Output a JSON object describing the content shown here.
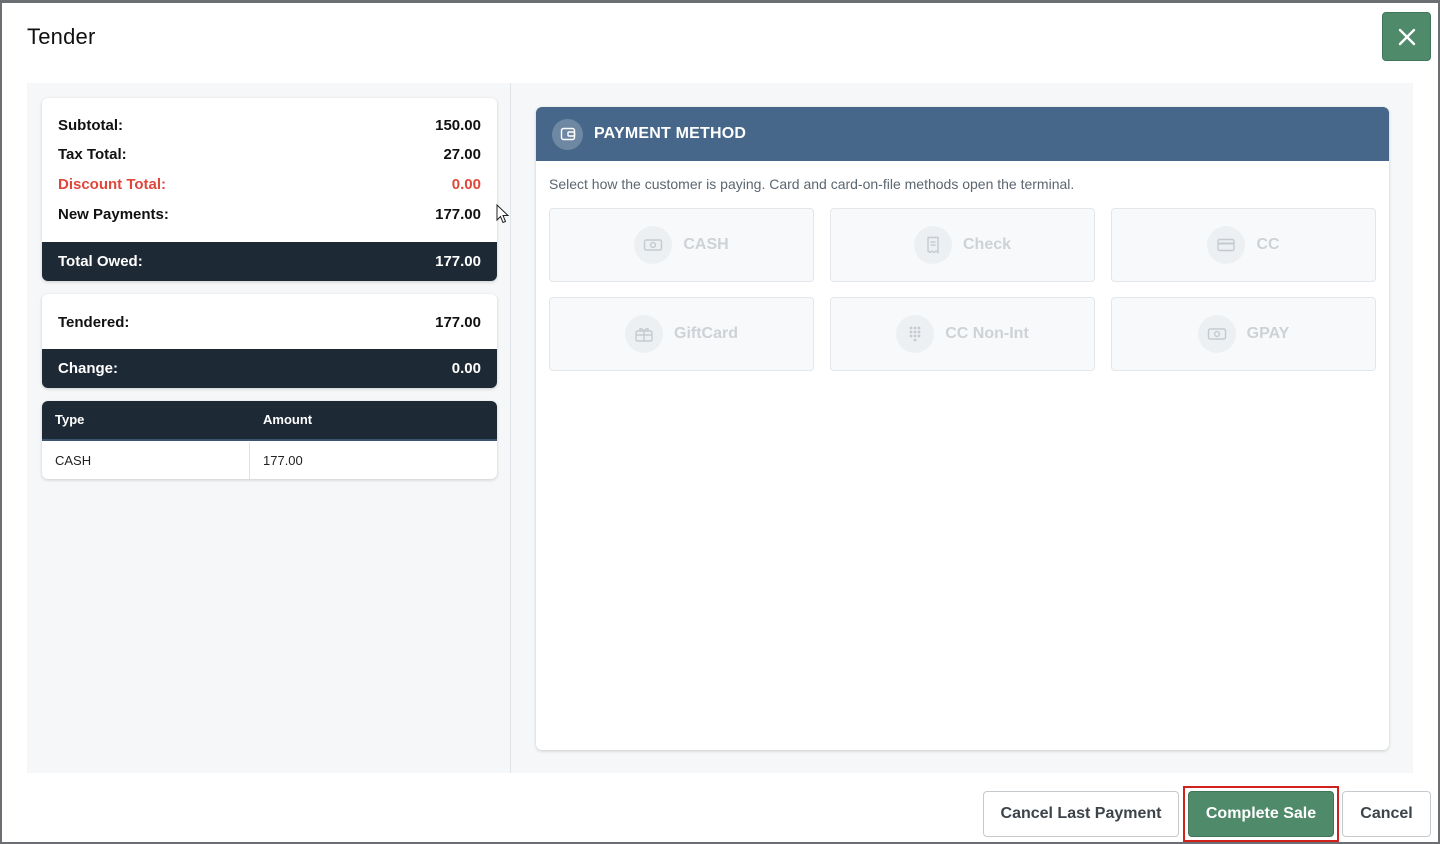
{
  "dialog": {
    "title": "Tender"
  },
  "summary": {
    "subtotal_label": "Subtotal:",
    "subtotal_value": "150.00",
    "tax_label": "Tax Total:",
    "tax_value": "27.00",
    "discount_label": "Discount Total:",
    "discount_value": "0.00",
    "new_payments_label": "New Payments:",
    "new_payments_value": "177.00",
    "total_owed_label": "Total Owed:",
    "total_owed_value": "177.00"
  },
  "tender": {
    "tendered_label": "Tendered:",
    "tendered_value": "177.00",
    "change_label": "Change:",
    "change_value": "0.00"
  },
  "payments_table": {
    "headers": [
      "Type",
      "Amount"
    ],
    "rows": [
      {
        "type": "CASH",
        "amount": "177.00"
      }
    ]
  },
  "payment_method": {
    "title": "PAYMENT METHOD",
    "hint": "Select how the customer is paying. Card and card-on-file methods open the terminal.",
    "methods": [
      {
        "label": "CASH",
        "icon": "cash-icon"
      },
      {
        "label": "Check",
        "icon": "check-receipt-icon"
      },
      {
        "label": "CC",
        "icon": "credit-card-icon"
      },
      {
        "label": "GiftCard",
        "icon": "gift-card-icon"
      },
      {
        "label": "CC Non-Int",
        "icon": "keypad-icon"
      },
      {
        "label": "GPAY",
        "icon": "wallet-cash-icon"
      }
    ]
  },
  "footer": {
    "cancel_last_payment": "Cancel Last Payment",
    "complete_sale": "Complete Sale",
    "cancel": "Cancel"
  },
  "colors": {
    "accent_green": "#4f8a6a",
    "header_blue": "#466789",
    "dark_navy": "#1d2935",
    "discount_red": "#e0473b",
    "highlight_red": "#d0211c"
  }
}
